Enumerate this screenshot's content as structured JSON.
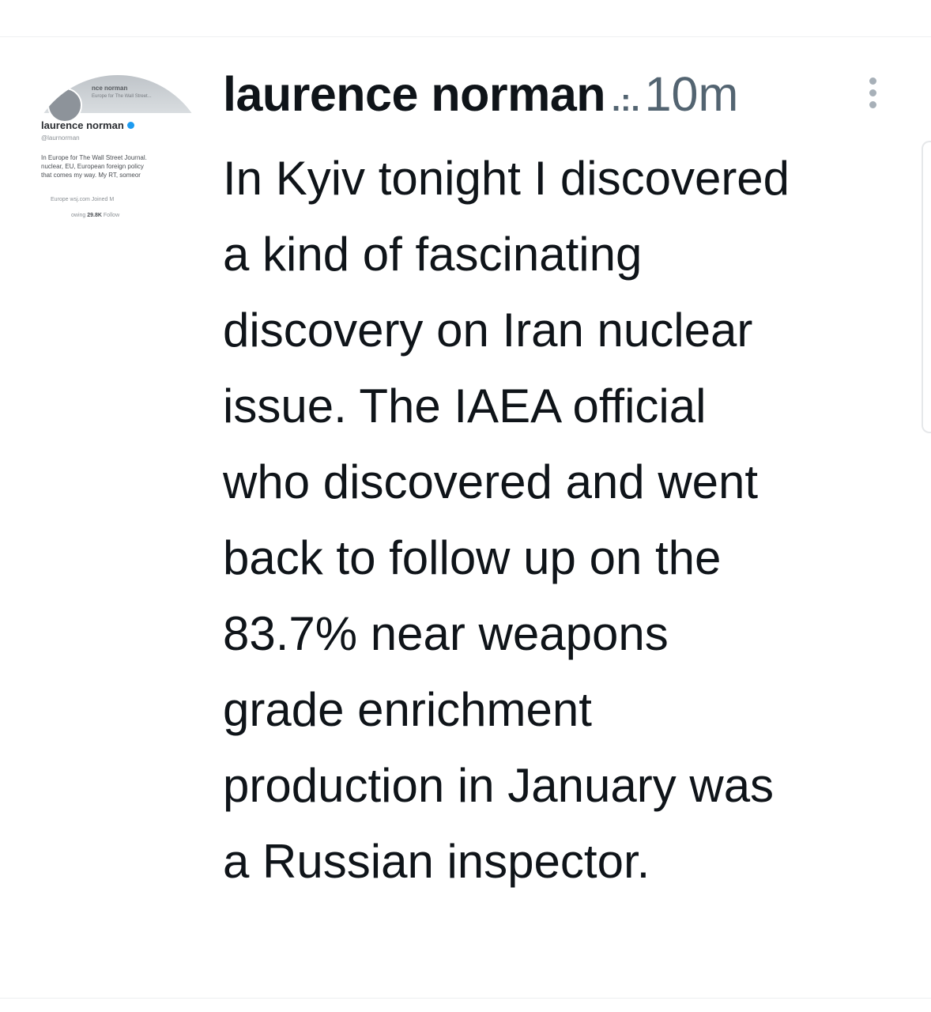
{
  "avatar": {
    "banner_name": "nce norman",
    "banner_sub": "Europe for The Wall Street...",
    "name": "laurence norman",
    "handle": "@laurnorman",
    "bio_lines": [
      "In Europe for The Wall Street Journal.",
      "nuclear, EU, European foreign policy",
      "that comes my way. My RT, someor"
    ],
    "meta": "Europe   wsj.com   Joined M",
    "following_label": "owing",
    "followers_count": "29.8K",
    "followers_label": "Follow"
  },
  "tweet": {
    "display_name": "laurence norman",
    "separator": ".:.",
    "time": "10m",
    "text_lines": [
      "In Kyiv tonight I discovered",
      "a kind of fascinating",
      "discovery on Iran nuclear",
      "issue. The IAEA official",
      "who discovered and went",
      "back to follow up on the",
      "83.7% near weapons",
      "grade enrichment",
      "production in January was",
      "a Russian inspector."
    ]
  },
  "icons": {
    "more": "vertical-ellipsis-icon",
    "verified": "verified-badge-icon"
  },
  "colors": {
    "text": "#0f1419",
    "secondary": "#536471",
    "verified": "#1d9bf0"
  }
}
